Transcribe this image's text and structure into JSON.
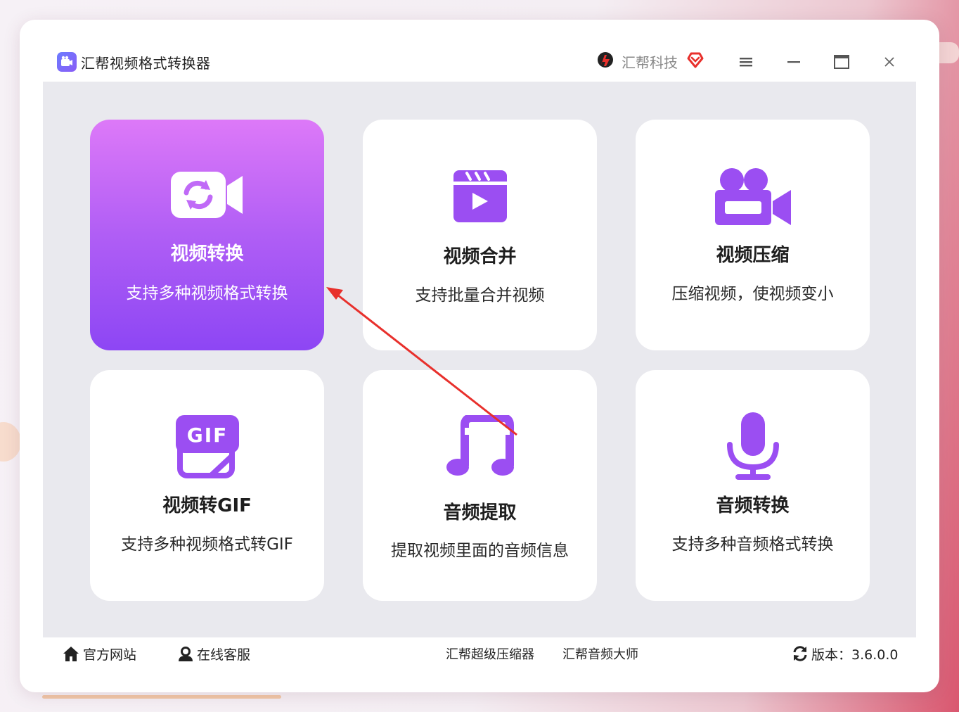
{
  "window": {
    "title": "汇帮视频格式转换器",
    "brand": "汇帮科技"
  },
  "cards": [
    {
      "title": "视频转换",
      "desc": "支持多种视频格式转换",
      "icon": "video-convert-icon"
    },
    {
      "title": "视频合并",
      "desc": "支持批量合并视频",
      "icon": "clapperboard-icon"
    },
    {
      "title": "视频压缩",
      "desc": "压缩视频，使视频变小",
      "icon": "video-camera-icon"
    },
    {
      "title": "视频转GIF",
      "desc": "支持多种视频格式转GIF",
      "icon": "gif-icon"
    },
    {
      "title": "音频提取",
      "desc": "提取视频里面的音频信息",
      "icon": "music-note-icon"
    },
    {
      "title": "音频转换",
      "desc": "支持多种音频格式转换",
      "icon": "microphone-icon"
    }
  ],
  "footer": {
    "website": "官方网站",
    "support": "在线客服",
    "compressor": "汇帮超级压缩器",
    "audio_master": "汇帮音频大师",
    "version": "版本：3.6.0.0"
  },
  "colors": {
    "accent": "#9b5cf6",
    "active_card_top": "#dd79f8",
    "active_card_bottom": "#8d46f4",
    "annotation_arrow": "#e8302c"
  }
}
